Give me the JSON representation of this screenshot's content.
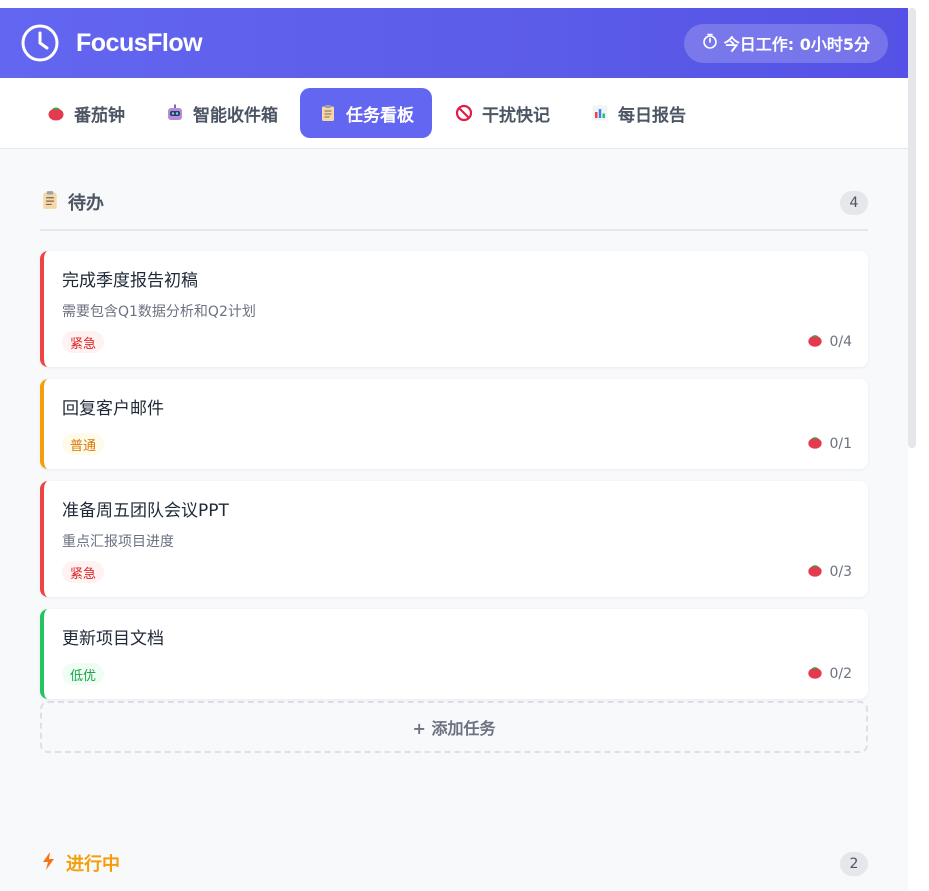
{
  "app": {
    "name": "FocusFlow",
    "work_today": "今日工作: 0小时5分"
  },
  "nav": {
    "tabs": [
      {
        "label": "番茄钟",
        "icon": "tomato-icon"
      },
      {
        "label": "智能收件箱",
        "icon": "robot-icon"
      },
      {
        "label": "任务看板",
        "icon": "clipboard-icon",
        "active": true
      },
      {
        "label": "干扰快记",
        "icon": "prohibited-icon"
      },
      {
        "label": "每日报告",
        "icon": "bar-chart-icon"
      }
    ]
  },
  "board": {
    "todo": {
      "title": "待办",
      "count": "4",
      "tasks": [
        {
          "title": "完成季度报告初稿",
          "desc": "需要包含Q1数据分析和Q2计划",
          "tag": "紧急",
          "priority": "urgent",
          "pomodoro": "0/4"
        },
        {
          "title": "回复客户邮件",
          "desc": "",
          "tag": "普通",
          "priority": "normal",
          "pomodoro": "0/1"
        },
        {
          "title": "准备周五团队会议PPT",
          "desc": "重点汇报项目进度",
          "tag": "紧急",
          "priority": "urgent",
          "pomodoro": "0/3"
        },
        {
          "title": "更新项目文档",
          "desc": "",
          "tag": "低优",
          "priority": "low",
          "pomodoro": "0/2"
        }
      ],
      "add_label": "+ 添加任务"
    },
    "in_progress": {
      "title": "进行中",
      "count": "2"
    }
  },
  "colors": {
    "accent": "#6366f1",
    "urgent": "#ef4444",
    "normal": "#f59e0b",
    "low": "#22c55e"
  }
}
